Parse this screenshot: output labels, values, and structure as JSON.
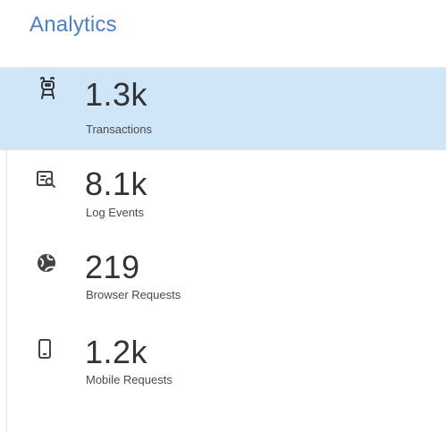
{
  "header": {
    "title": "Analytics"
  },
  "metrics": [
    {
      "value": "1.3k",
      "label": "Transactions",
      "icon": "transactions-icon",
      "active": true
    },
    {
      "value": "8.1k",
      "label": "Log Events",
      "icon": "log-search-icon",
      "active": false
    },
    {
      "value": "219",
      "label": "Browser Requests",
      "icon": "globe-icon",
      "active": false
    },
    {
      "value": "1.2k",
      "label": "Mobile Requests",
      "icon": "mobile-icon",
      "active": false
    }
  ],
  "colors": {
    "accent": "#4b7fcf",
    "active_row": "#cfe5f8",
    "text": "#333333"
  }
}
